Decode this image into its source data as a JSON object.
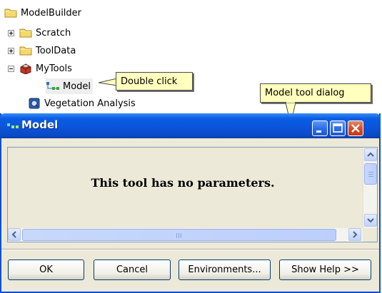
{
  "tree": {
    "root_label": "ModelBuilder",
    "items": [
      {
        "label": "Scratch",
        "icon": "folder-icon",
        "expander": "plus"
      },
      {
        "label": "ToolData",
        "icon": "folder-icon",
        "expander": "plus"
      },
      {
        "label": "MyTools",
        "icon": "toolbox-icon",
        "expander": "minus"
      }
    ],
    "model_label": "Model",
    "vegetation_label": "Vegetation Analysis"
  },
  "callouts": {
    "double_click": "Double click",
    "model_tool_dialog": "Model tool dialog"
  },
  "dialog": {
    "title": "Model",
    "message": "This tool has no parameters.",
    "buttons": {
      "ok": "OK",
      "cancel": "Cancel",
      "environments": "Environments...",
      "show_help": "Show Help >>"
    }
  },
  "colors": {
    "titlebar": "#0a5ee4",
    "callout_bg": "#ffffbe",
    "dialog_bg": "#ece9d8",
    "close_button": "#d84a1c"
  }
}
